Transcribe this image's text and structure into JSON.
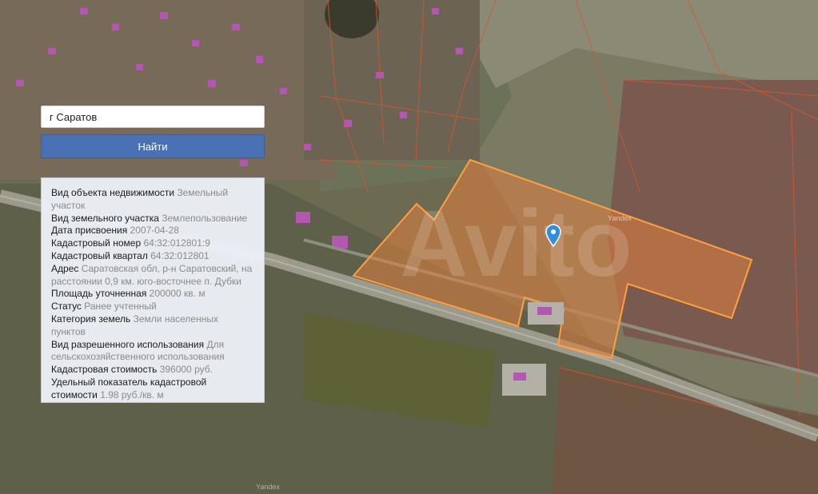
{
  "search": {
    "value": "г Саратов",
    "button_label": "Найти"
  },
  "info": {
    "rows": [
      {
        "label": "Вид объекта недвижимости",
        "value": "Земельный участок"
      },
      {
        "label": "Вид земельного участка",
        "value": "Землепользование"
      },
      {
        "label": "Дата присвоения",
        "value": "2007-04-28"
      },
      {
        "label": "Кадастровый номер",
        "value": "64:32:012801:9"
      },
      {
        "label": "Кадастровый квартал",
        "value": "64:32:012801"
      },
      {
        "label": "Адрес",
        "value": "Саратовская обл, р-н Саратовский, на расстоянии 0,9 км. юго-восточнее п. Дубки"
      },
      {
        "label": "Площадь уточненная",
        "value": "200000 кв. м"
      },
      {
        "label": "Статус",
        "value": "Ранее учтенный"
      },
      {
        "label": "Категория земель",
        "value": "Земли населенных пунктов"
      },
      {
        "label": "Вид разрешенного использования",
        "value": "Для сельскохозяйственного использования"
      },
      {
        "label": "Кадастровая стоимость",
        "value": "396000 руб."
      },
      {
        "label": "Удельный показатель кадастровой стоимости",
        "value": "1.98 руб./кв. м"
      }
    ]
  },
  "map": {
    "watermark_avito": "Avito",
    "watermark_yandex": "Yandex",
    "marker_icon": "map-pin-icon",
    "colors": {
      "parcel_fill": "#e0803e",
      "parcel_stroke": "#ffa040",
      "boundary_stroke": "#d9552e",
      "marker": "#2f8ee0",
      "search_button": "#4a71b4"
    }
  }
}
